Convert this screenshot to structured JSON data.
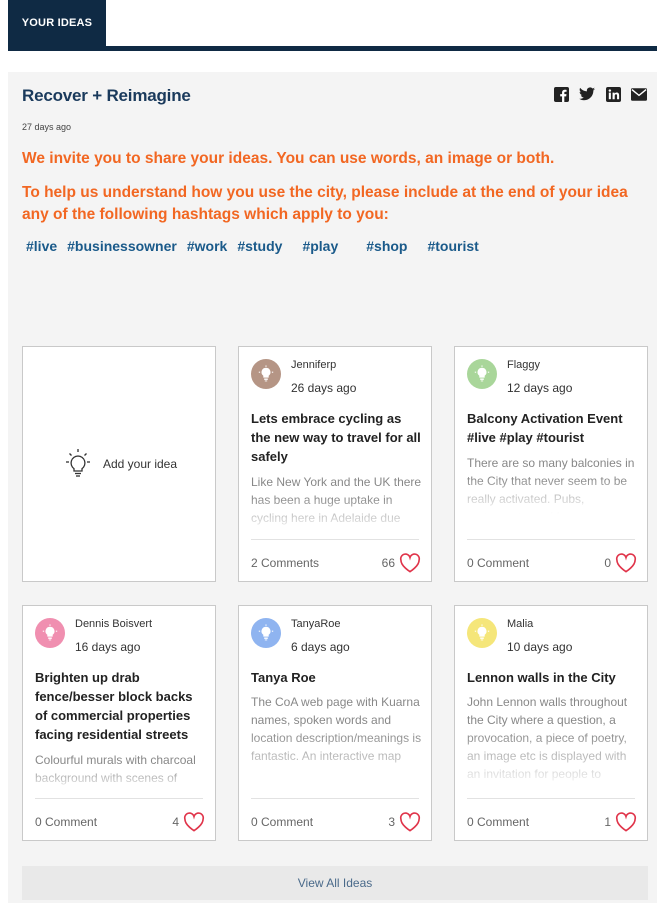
{
  "tab": {
    "label": "YOUR IDEAS"
  },
  "header": {
    "title": "Recover + Reimagine",
    "date": "27 days ago",
    "share_icons": [
      "facebook-icon",
      "twitter-icon",
      "linkedin-icon",
      "email-icon"
    ]
  },
  "intro": {
    "line1": "We invite you to share your ideas. You can use words, an image or both.",
    "line2": "To help us understand how you use the city, please include at the end of your idea any of the following hashtags which apply to you:"
  },
  "hashtags": [
    "#live",
    "#businessowner",
    "#work",
    "#study",
    "#play",
    "#shop",
    "#tourist"
  ],
  "add_idea": {
    "label": "Add your idea"
  },
  "ideas": [
    {
      "user": "Jenniferp",
      "ago": "26 days ago",
      "title": "Lets embrace cycling as the new way to travel for all safely",
      "desc": "Like New York and the UK there has been a huge uptake in cycling here in Adelaide due",
      "comments": "2 Comments",
      "likes": "66",
      "avatar_color": "#b59585"
    },
    {
      "user": "Flaggy",
      "ago": "12 days ago",
      "title": "Balcony Activation Event #live #play #tourist",
      "desc": "There are so many balconies in the City that never seem to be really activated. Pubs, restaurants, residences,",
      "comments": "0 Comment",
      "likes": "0",
      "avatar_color": "#a9d69a"
    },
    {
      "user": "Dennis Boisvert",
      "ago": "16 days ago",
      "title": "Brighten up drab fence/besser block backs of commercial properties facing residential streets",
      "desc": "Colourful murals with charcoal background with scenes of",
      "comments": "0 Comment",
      "likes": "4",
      "avatar_color": "#f08fb0"
    },
    {
      "user": "TanyaRoe",
      "ago": "6 days ago",
      "title": "Tanya Roe",
      "desc": "The CoA web page with Kuarna names, spoken words and location description/meanings is fantastic. An interactive map",
      "comments": "0 Comment",
      "likes": "3",
      "avatar_color": "#8fb4f0"
    },
    {
      "user": "Malia",
      "ago": "10 days ago",
      "title": "Lennon walls in the City",
      "desc": "John Lennon walls throughout the City where a question, a provocation, a piece of poetry, an image etc is displayed with an invitation for people to",
      "comments": "0 Comment",
      "likes": "1",
      "avatar_color": "#f5e67a"
    }
  ],
  "footer": {
    "view_all": "View All Ideas"
  },
  "colors": {
    "navy": "#0f2a44",
    "accent_orange": "#f26722",
    "hashtag_blue": "#1a5a8a",
    "heart_red": "#e0344a"
  }
}
